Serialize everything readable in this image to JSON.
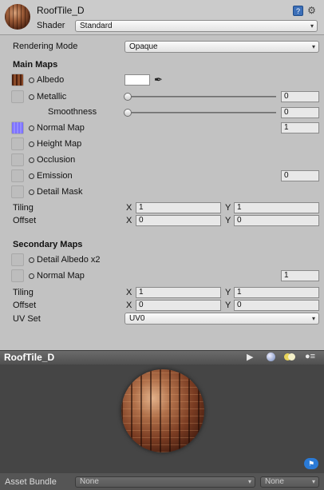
{
  "header": {
    "title": "RoofTile_D",
    "shader_label": "Shader",
    "shader_value": "Standard"
  },
  "rendering": {
    "label": "Rendering Mode",
    "value": "Opaque"
  },
  "main_maps": {
    "heading": "Main Maps",
    "albedo": {
      "label": "Albedo",
      "color": "#ffffff"
    },
    "metallic": {
      "label": "Metallic",
      "value": "0",
      "slider": 0
    },
    "smoothness": {
      "label": "Smoothness",
      "value": "0",
      "slider": 0
    },
    "normal_map": {
      "label": "Normal Map",
      "value": "1"
    },
    "height_map": {
      "label": "Height Map"
    },
    "occlusion": {
      "label": "Occlusion"
    },
    "emission": {
      "label": "Emission",
      "value": "0"
    },
    "detail_mask": {
      "label": "Detail Mask"
    },
    "tiling": {
      "label": "Tiling",
      "x_label": "X",
      "x": "1",
      "y_label": "Y",
      "y": "1"
    },
    "offset": {
      "label": "Offset",
      "x_label": "X",
      "x": "0",
      "y_label": "Y",
      "y": "0"
    }
  },
  "secondary_maps": {
    "heading": "Secondary Maps",
    "detail_albedo": {
      "label": "Detail Albedo x2"
    },
    "normal_map": {
      "label": "Normal Map",
      "value": "1"
    },
    "tiling": {
      "label": "Tiling",
      "x_label": "X",
      "x": "1",
      "y_label": "Y",
      "y": "1"
    },
    "offset": {
      "label": "Offset",
      "x_label": "X",
      "x": "0",
      "y_label": "Y",
      "y": "0"
    },
    "uv_set": {
      "label": "UV Set",
      "value": "UV0"
    }
  },
  "preview": {
    "title": "RoofTile_D",
    "play_icon": "play-icon",
    "sphere_icon": "sphere-icon",
    "light_icon": "light-icon",
    "menu_icon": "menu-icon"
  },
  "asset_bundle": {
    "label": "Asset Bundle",
    "bundle_value": "None",
    "variant_value": "None"
  },
  "colors": {
    "accent": "#2a7ad6",
    "normal_thumb": "#8a7fff"
  }
}
